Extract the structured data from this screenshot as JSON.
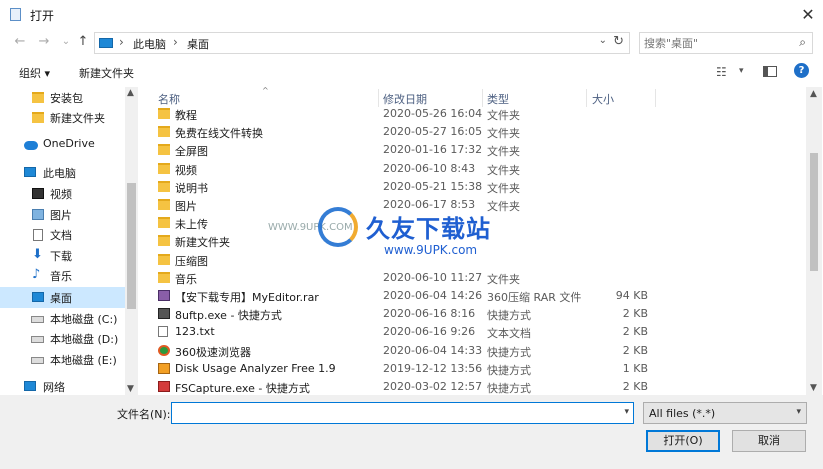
{
  "window": {
    "title": "打开",
    "close_glyph": "✕"
  },
  "nav": {
    "back": "←",
    "forward": "→",
    "recent": "⌄",
    "up": "↑"
  },
  "address": {
    "crumbs": [
      "此电脑",
      "桌面"
    ],
    "separator": "›",
    "dropdown": "⌄",
    "refresh": "↻"
  },
  "search": {
    "placeholder": "搜索\"桌面\"",
    "icon": "⌕"
  },
  "toolbar": {
    "organize": "组织 ▾",
    "new_folder": "新建文件夹",
    "view_icon": "☷",
    "view_drop": "▾",
    "help": "?"
  },
  "sidebar": {
    "items": [
      {
        "label": "安装包",
        "icon": "folder"
      },
      {
        "label": "新建文件夹",
        "icon": "folder"
      },
      {
        "label": "OneDrive",
        "icon": "cloud"
      },
      {
        "label": "此电脑",
        "icon": "pc"
      },
      {
        "label": "视频",
        "icon": "video"
      },
      {
        "label": "图片",
        "icon": "pics"
      },
      {
        "label": "文档",
        "icon": "docs"
      },
      {
        "label": "下载",
        "icon": "down"
      },
      {
        "label": "音乐",
        "icon": "music"
      },
      {
        "label": "桌面",
        "icon": "desk",
        "selected": true
      },
      {
        "label": "本地磁盘 (C:)",
        "icon": "drive"
      },
      {
        "label": "本地磁盘 (D:)",
        "icon": "drive"
      },
      {
        "label": "本地磁盘 (E:)",
        "icon": "drive"
      },
      {
        "label": "网络",
        "icon": "net"
      }
    ],
    "scroll_up": "▲",
    "scroll_down": "▼"
  },
  "columns": {
    "name": "名称",
    "date": "修改日期",
    "type": "类型",
    "size": "大小",
    "sort": "^"
  },
  "files": [
    {
      "name": "教程",
      "date": "2020-05-26 16:04",
      "type": "文件夹",
      "size": "",
      "icon": "folder"
    },
    {
      "name": "免费在线文件转换",
      "date": "2020-05-27 16:05",
      "type": "文件夹",
      "size": "",
      "icon": "folder"
    },
    {
      "name": "全屏图",
      "date": "2020-01-16 17:32",
      "type": "文件夹",
      "size": "",
      "icon": "folder"
    },
    {
      "name": "视频",
      "date": "2020-06-10 8:43",
      "type": "文件夹",
      "size": "",
      "icon": "folder"
    },
    {
      "name": "说明书",
      "date": "2020-05-21 15:38",
      "type": "文件夹",
      "size": "",
      "icon": "folder"
    },
    {
      "name": "图片",
      "date": "2020-06-17 8:53",
      "type": "文件夹",
      "size": "",
      "icon": "folder"
    },
    {
      "name": "未上传",
      "date": "",
      "type": "",
      "size": "",
      "icon": "folder"
    },
    {
      "name": "新建文件夹",
      "date": "",
      "type": "",
      "size": "",
      "icon": "folder"
    },
    {
      "name": "压缩图",
      "date": "",
      "type": "",
      "size": "",
      "icon": "folder"
    },
    {
      "name": "音乐",
      "date": "2020-06-10 11:27",
      "type": "文件夹",
      "size": "",
      "icon": "folder"
    },
    {
      "name": "【安下载专用】MyEditor.rar",
      "date": "2020-06-04 14:26",
      "type": "360压缩 RAR 文件",
      "size": "94 KB",
      "icon": "rar"
    },
    {
      "name": "8uftp.exe - 快捷方式",
      "date": "2020-06-16 8:16",
      "type": "快捷方式",
      "size": "2 KB",
      "icon": "exe"
    },
    {
      "name": "123.txt",
      "date": "2020-06-16 9:26",
      "type": "文本文档",
      "size": "2 KB",
      "icon": "txt"
    },
    {
      "name": "360极速浏览器",
      "date": "2020-06-04 14:33",
      "type": "快捷方式",
      "size": "2 KB",
      "icon": "browser"
    },
    {
      "name": "Disk Usage Analyzer Free 1.9",
      "date": "2019-12-12 13:56",
      "type": "快捷方式",
      "size": "1 KB",
      "icon": "disk"
    },
    {
      "name": "FSCapture.exe - 快捷方式",
      "date": "2020-03-02 12:57",
      "type": "快捷方式",
      "size": "2 KB",
      "icon": "fsc"
    }
  ],
  "watermark": {
    "title": "久友下载站",
    "site": "www.9UPK.com",
    "left": "WWW.9UPK.COM"
  },
  "main_scroll": {
    "up": "▲",
    "down": "▼"
  },
  "footer": {
    "filename_label": "文件名(N):",
    "filename_value": "",
    "filename_drop": "▾",
    "filter_value": "All files (*.*)",
    "filter_drop": "▾",
    "open_label": "打开(O)",
    "cancel_label": "取消"
  }
}
